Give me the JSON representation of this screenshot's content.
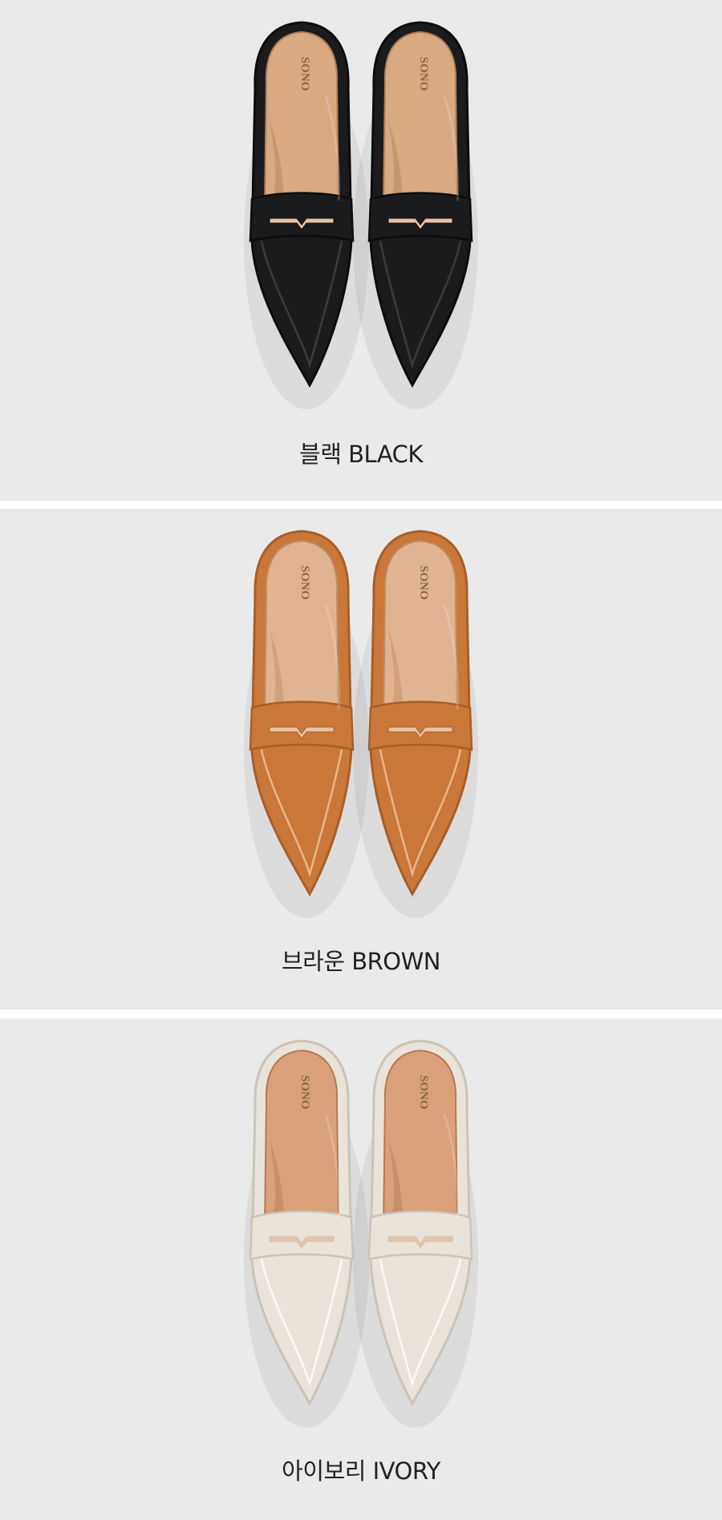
{
  "variants": [
    {
      "label": "블랙 BLACK",
      "upper_color": "#1b1b1d",
      "upper_shade": "#0c0c0d",
      "stitch_color": "#3a3a3c",
      "insole_color": "#d9a982",
      "insole_shade": "#b27e57",
      "brand_mark": "SONO"
    },
    {
      "label": "브라운 BROWN",
      "upper_color": "#c9783a",
      "upper_shade": "#a85f27",
      "stitch_color": "#e9b789",
      "insole_color": "#e0b490",
      "insole_shade": "#be8a63",
      "brand_mark": "SONO"
    },
    {
      "label": "아이보리 IVORY",
      "upper_color": "#e9e3da",
      "upper_shade": "#cbc4b9",
      "stitch_color": "#fbf8f3",
      "insole_color": "#d9a07a",
      "insole_shade": "#b47a56",
      "brand_mark": "SONO"
    }
  ]
}
